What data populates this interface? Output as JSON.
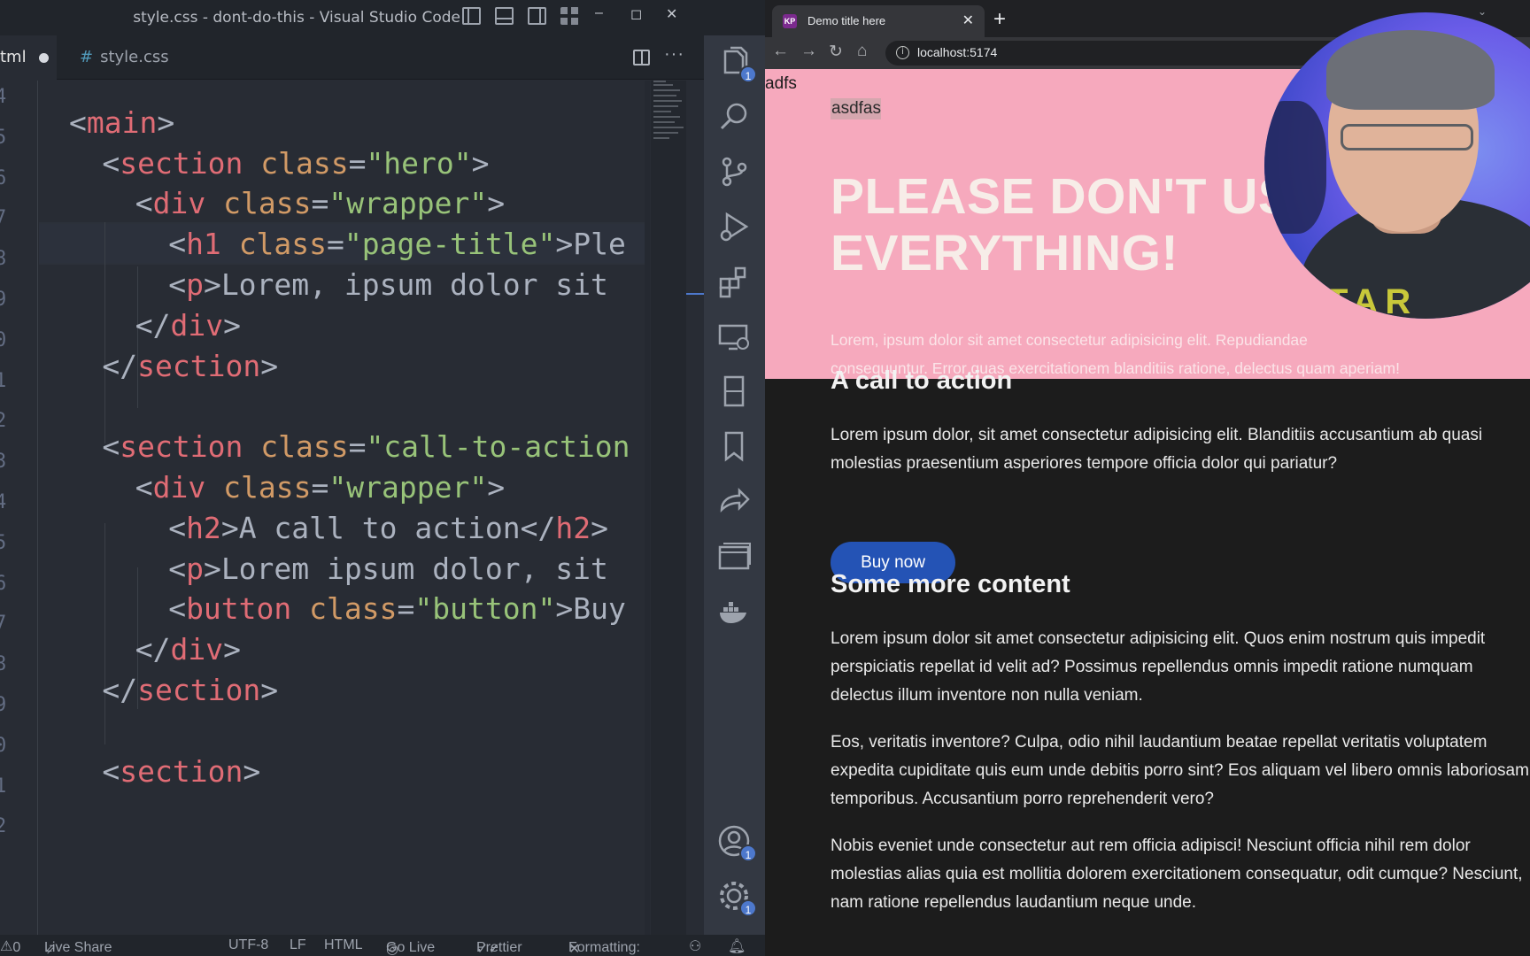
{
  "vscode": {
    "title": "style.css - dont-do-this - Visual Studio Code",
    "window_controls": [
      "–",
      "◻",
      "✕"
    ],
    "tabs": [
      {
        "label": "tml",
        "modified": true
      },
      {
        "label": "style.css"
      }
    ],
    "gutter": [
      "4",
      "5",
      "6",
      "7",
      "8",
      "9",
      "0",
      "1",
      "2",
      "3",
      "4",
      "5",
      "6",
      "7",
      "8",
      "9",
      "0",
      "1",
      "2"
    ],
    "code": [
      {
        "indent": 0,
        "parts": []
      },
      {
        "indent": 2,
        "parts": [
          [
            "punc",
            "<"
          ],
          [
            "tag",
            "main"
          ],
          [
            "punc",
            ">"
          ]
        ]
      },
      {
        "indent": 4,
        "parts": [
          [
            "punc",
            "<"
          ],
          [
            "tag",
            "section"
          ],
          [
            "punc",
            " "
          ],
          [
            "attr",
            "class"
          ],
          [
            "punc",
            "="
          ],
          [
            "str",
            "\"hero\""
          ],
          [
            "punc",
            ">"
          ]
        ]
      },
      {
        "indent": 6,
        "parts": [
          [
            "punc",
            "<"
          ],
          [
            "tag",
            "div"
          ],
          [
            "punc",
            " "
          ],
          [
            "attr",
            "class"
          ],
          [
            "punc",
            "="
          ],
          [
            "str",
            "\"wrapper\""
          ],
          [
            "punc",
            ">"
          ]
        ]
      },
      {
        "indent": 8,
        "parts": [
          [
            "punc",
            "<"
          ],
          [
            "tag",
            "h1"
          ],
          [
            "punc",
            " "
          ],
          [
            "attr",
            "class"
          ],
          [
            "punc",
            "="
          ],
          [
            "str",
            "\"page-title\""
          ],
          [
            "punc",
            ">"
          ],
          [
            "text",
            "Ple"
          ]
        ]
      },
      {
        "indent": 8,
        "parts": [
          [
            "punc",
            "<"
          ],
          [
            "tag",
            "p"
          ],
          [
            "punc",
            ">"
          ],
          [
            "text",
            "Lorem, ipsum dolor sit"
          ]
        ]
      },
      {
        "indent": 6,
        "parts": [
          [
            "punc",
            "</"
          ],
          [
            "tag",
            "div"
          ],
          [
            "punc",
            ">"
          ]
        ]
      },
      {
        "indent": 4,
        "parts": [
          [
            "punc",
            "</"
          ],
          [
            "tag",
            "section"
          ],
          [
            "punc",
            ">"
          ]
        ]
      },
      {
        "indent": 0,
        "parts": []
      },
      {
        "indent": 4,
        "parts": [
          [
            "punc",
            "<"
          ],
          [
            "tag",
            "section"
          ],
          [
            "punc",
            " "
          ],
          [
            "attr",
            "class"
          ],
          [
            "punc",
            "="
          ],
          [
            "str",
            "\"call-to-action"
          ]
        ]
      },
      {
        "indent": 6,
        "parts": [
          [
            "punc",
            "<"
          ],
          [
            "tag",
            "div"
          ],
          [
            "punc",
            " "
          ],
          [
            "attr",
            "class"
          ],
          [
            "punc",
            "="
          ],
          [
            "str",
            "\"wrapper\""
          ],
          [
            "punc",
            ">"
          ]
        ]
      },
      {
        "indent": 8,
        "parts": [
          [
            "punc",
            "<"
          ],
          [
            "tag",
            "h2"
          ],
          [
            "punc",
            ">"
          ],
          [
            "text",
            "A call to action"
          ],
          [
            "punc",
            "</"
          ],
          [
            "tag",
            "h2"
          ],
          [
            "punc",
            ">"
          ]
        ]
      },
      {
        "indent": 8,
        "parts": [
          [
            "punc",
            "<"
          ],
          [
            "tag",
            "p"
          ],
          [
            "punc",
            ">"
          ],
          [
            "text",
            "Lorem ipsum dolor, sit"
          ]
        ]
      },
      {
        "indent": 8,
        "parts": [
          [
            "punc",
            "<"
          ],
          [
            "tag",
            "button"
          ],
          [
            "punc",
            " "
          ],
          [
            "attr",
            "class"
          ],
          [
            "punc",
            "="
          ],
          [
            "str",
            "\"button\""
          ],
          [
            "punc",
            ">"
          ],
          [
            "text",
            "Buy"
          ]
        ]
      },
      {
        "indent": 6,
        "parts": [
          [
            "punc",
            "</"
          ],
          [
            "tag",
            "div"
          ],
          [
            "punc",
            ">"
          ]
        ]
      },
      {
        "indent": 4,
        "parts": [
          [
            "punc",
            "</"
          ],
          [
            "tag",
            "section"
          ],
          [
            "punc",
            ">"
          ]
        ]
      },
      {
        "indent": 0,
        "parts": []
      },
      {
        "indent": 4,
        "parts": [
          [
            "punc",
            "<"
          ],
          [
            "tag",
            "section"
          ],
          [
            "punc",
            ">"
          ]
        ]
      }
    ],
    "activity_badges": {
      "explorer": "1",
      "accounts": "1",
      "settings": "1"
    },
    "status": {
      "problems": "0",
      "live_share": "Live Share",
      "encoding": "UTF-8",
      "eol": "LF",
      "language": "HTML",
      "go_live": "Go Live",
      "prettier": "Prettier",
      "formatting": "Formatting:"
    },
    "colors": {
      "tag": "#e06c75",
      "attr": "#d19a66",
      "string": "#98c379",
      "text": "#abb2bf"
    }
  },
  "browser": {
    "tab_title": "Demo title here",
    "favicon": "KP",
    "url": "localhost:5174",
    "page": {
      "adfs": "adfs",
      "asdfas": "asdfas",
      "hero_title": "PLEASE DON'T US\nEVERYTHING!",
      "hero_text": "Lorem, ipsum dolor sit amet consectetur adipisicing elit. Repudiandae\nconsequuntur. Error quas exercitationem blanditiis ratione, delectus quam aperiam!",
      "cta_heading": "A call to action",
      "cta_text": "Lorem ipsum dolor, sit amet consectetur adipisicing elit. Blanditiis accusantium ab quasi molestias praesentium asperiores tempore officia dolor qui pariatur?",
      "buy_button": "Buy now",
      "more_heading": "Some more content",
      "para1": "Lorem ipsum dolor sit amet consectetur adipisicing elit. Quos enim nostrum quis impedit perspiciatis repellat id velit ad? Possimus repellendus omnis impedit ratione numquam delectus illum inventore non nulla veniam.",
      "para2": "Eos, veritatis inventore? Culpa, odio nihil laudantium beatae repellat veritatis voluptatem expedita cupiditate quis eum unde debitis porro sint? Eos aliquam vel libero omnis laboriosam temporibus. Accusantium porro reprehenderit vero?",
      "para3": "Nobis eveniet unde consectetur aut rem officia adipisci! Nesciunt officia nihil rem dolor molestias alias quia est mollitia dolorem exercitationem consequatur, odit cumque? Nesciunt, nam ratione repellendus laudantium neque unde."
    },
    "colors": {
      "hero_bg": "#f6a9bd",
      "button_bg": "#2453b5",
      "page_bg": "#1c1c1c"
    }
  },
  "webcam": {
    "shirt_text": "TAR"
  }
}
